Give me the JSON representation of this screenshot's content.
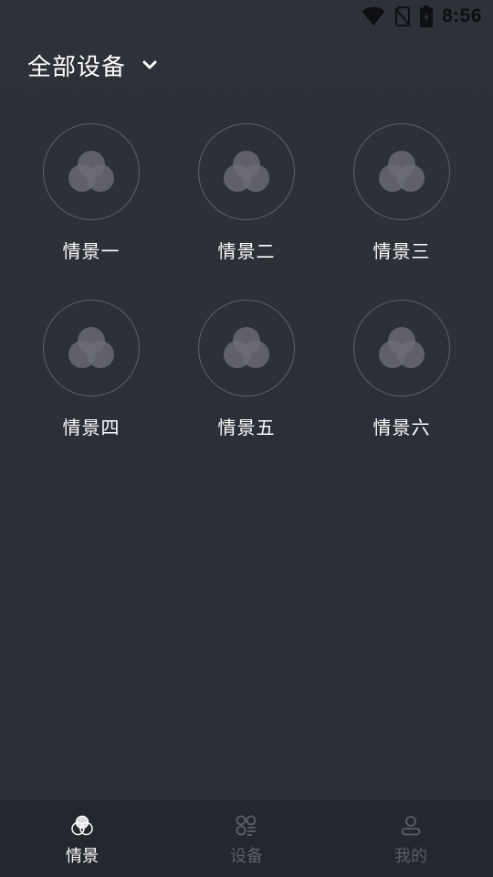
{
  "status_bar": {
    "time": "8:56",
    "icons": [
      "wifi-icon",
      "no-sim-icon",
      "battery-charging-icon"
    ]
  },
  "header": {
    "title": "全部设备",
    "dropdown_icon": "chevron-down-icon"
  },
  "scenes": [
    {
      "label": "情景一",
      "icon": "scene-circles-icon"
    },
    {
      "label": "情景二",
      "icon": "scene-circles-icon"
    },
    {
      "label": "情景三",
      "icon": "scene-circles-icon"
    },
    {
      "label": "情景四",
      "icon": "scene-circles-icon"
    },
    {
      "label": "情景五",
      "icon": "scene-circles-icon"
    },
    {
      "label": "情景六",
      "icon": "scene-circles-icon"
    }
  ],
  "tabbar": {
    "tabs": [
      {
        "label": "情景",
        "icon": "scene-tab-icon",
        "active": true
      },
      {
        "label": "设备",
        "icon": "device-tab-icon",
        "active": false
      },
      {
        "label": "我的",
        "icon": "profile-tab-icon",
        "active": false
      }
    ]
  },
  "colors": {
    "background": "#2e3039",
    "tabbar_background": "#25272e",
    "text_primary": "#ffffff",
    "text_inactive": "#5c5e67",
    "circle_border": "#5f616b",
    "icon_fill": "#6b6d75"
  }
}
